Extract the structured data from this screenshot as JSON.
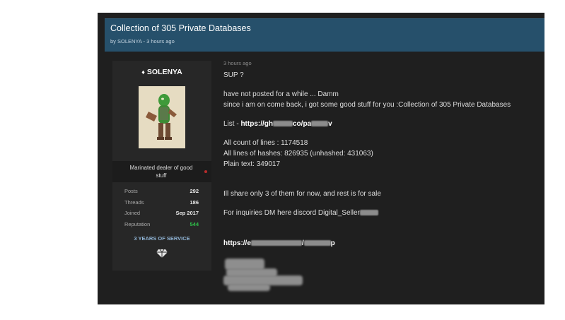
{
  "thread": {
    "title": "Collection of 305 Private Databases",
    "byline": "by SOLENYA - 3 hours ago"
  },
  "user": {
    "name": "SOLENYA",
    "title": "Marinated dealer of good stuff",
    "stats": [
      {
        "label": "Posts",
        "value": "292"
      },
      {
        "label": "Threads",
        "value": "186"
      },
      {
        "label": "Joined",
        "value": "Sep 2017"
      },
      {
        "label": "Reputation",
        "value": "544"
      }
    ],
    "service": "3 YEARS OF SERVICE"
  },
  "post": {
    "time": "3 hours ago",
    "greeting": "SUP ?",
    "intro1": "have not posted for a while ... Damm",
    "intro2": "since i am on come back, i got some good stuff for you :Collection of 305 Private Databases",
    "list_label": "List - ",
    "list_link_a": "https://gh",
    "list_link_b": "co/pa",
    "list_link_c": "v",
    "count_lines": "All count of lines : 1174518",
    "hash_lines": "All lines of hashes: 826935 (unhashed: 431063)",
    "plain_text": "Plain text: 349017",
    "share": "Ill share only 3 of them for now, and rest is for sale",
    "inquiries": "For inquiries DM here discord Digital_Seller",
    "url_a": "https://e",
    "url_b": "/",
    "url_c": "p"
  },
  "colors": {
    "title_bar": "#26506b",
    "page_background": "#1f1f1f",
    "user_pane": "#272727",
    "reputation_green": "#2ec24a",
    "service_blue": "#8fb3d4"
  }
}
